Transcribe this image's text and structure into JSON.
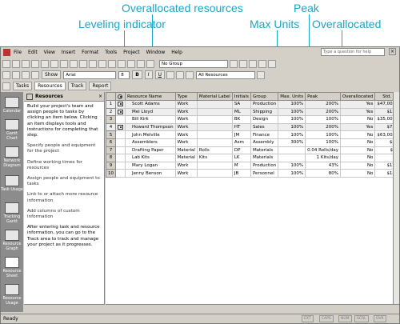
{
  "callouts": {
    "overallocated_resources": "Overallocated resources",
    "leveling_indicator": "Leveling indicator",
    "peak": "Peak",
    "max_units": "Max Units",
    "overallocated": "Overallocated"
  },
  "menu": [
    "File",
    "Edit",
    "View",
    "Insert",
    "Format",
    "Tools",
    "Project",
    "Window",
    "Help"
  ],
  "help_placeholder": "Type a question for help",
  "toolbar": {
    "group_value": "No Group",
    "show_label": "Show",
    "font_value": "Arial",
    "font_size": "8",
    "bold": "B",
    "italic": "I",
    "underline": "U",
    "filter_value": "All Resources"
  },
  "guide_toolbar": [
    "Tasks",
    "Resources",
    "Track",
    "Report"
  ],
  "viewbar": [
    "Calendar",
    "Gantt Chart",
    "Network Diagram",
    "Task Usage",
    "Tracking Gantt",
    "Resource Graph",
    "Resource Sheet",
    "Resource Usage"
  ],
  "guide": {
    "title": "Resources",
    "intro": "Build your project's team and assign people to tasks by clicking an item below. Clicking an item displays tools and instructions for completing that step.",
    "links": [
      "Specify people and equipment for the project",
      "Define working times for resources",
      "Assign people and equipment to tasks",
      "Link to or attach more resource information",
      "Add columns of custom information"
    ],
    "footer": "After entering task and resource information, you can go to the Track area to track and manage your project as it progresses."
  },
  "table": {
    "columns": [
      "",
      "Resource Name",
      "Type",
      "Material Label",
      "Initials",
      "Group",
      "Max. Units",
      "Peak",
      "Overallocated",
      "Std. Rate",
      "O"
    ],
    "rows": [
      {
        "n": "1",
        "ind": true,
        "name": "Scott Adams",
        "type": "Work",
        "label": "",
        "init": "SA",
        "group": "Production",
        "max": "100%",
        "peak": "200%",
        "over": "Yes",
        "rate": "$47,000.00/yr"
      },
      {
        "n": "2",
        "ind": true,
        "name": "Mel Lloyd",
        "type": "Work",
        "label": "",
        "init": "ML",
        "group": "Shipping",
        "max": "100%",
        "peak": "200%",
        "over": "Yes",
        "rate": "$15.00/hr"
      },
      {
        "n": "3",
        "ind": false,
        "name": "Bill Kirk",
        "type": "Work",
        "label": "",
        "init": "BK",
        "group": "Design",
        "max": "100%",
        "peak": "100%",
        "over": "No",
        "rate": "$35,000.00/yr"
      },
      {
        "n": "4",
        "ind": true,
        "name": "Howard Thompson",
        "type": "Work",
        "label": "",
        "init": "HT",
        "group": "Sales",
        "max": "100%",
        "peak": "200%",
        "over": "Yes",
        "rate": "$73.50/hr"
      },
      {
        "n": "5",
        "ind": false,
        "name": "John Melville",
        "type": "Work",
        "label": "",
        "init": "JM",
        "group": "Finance",
        "max": "100%",
        "peak": "100%",
        "over": "No",
        "rate": "$63,000.00/yr"
      },
      {
        "n": "6",
        "ind": false,
        "name": "Assemblers",
        "type": "Work",
        "label": "",
        "init": "Asm",
        "group": "Assembly",
        "max": "300%",
        "peak": "100%",
        "over": "No",
        "rate": "$8.50/hr"
      },
      {
        "n": "7",
        "ind": false,
        "name": "Drafting Paper",
        "type": "Material",
        "label": "Rolls",
        "init": "DP",
        "group": "Materials",
        "max": "",
        "peak": "0.04 Rolls/day",
        "over": "No",
        "rate": "$100.00"
      },
      {
        "n": "8",
        "ind": false,
        "name": "Lab Kits",
        "type": "Material",
        "label": "Kits",
        "init": "LK",
        "group": "Materials",
        "max": "",
        "peak": "1 Kits/day",
        "over": "No",
        "rate": "$10.00"
      },
      {
        "n": "9",
        "ind": false,
        "name": "Mary Logan",
        "type": "Work",
        "label": "",
        "init": "M",
        "group": "Production",
        "max": "100%",
        "peak": "43%",
        "over": "No",
        "rate": "$12.00/hr"
      },
      {
        "n": "10",
        "ind": false,
        "name": "Jenny Benson",
        "type": "Work",
        "label": "",
        "init": "JB",
        "group": "Personnel",
        "max": "100%",
        "peak": "80%",
        "over": "No",
        "rate": "$18.00/hr"
      }
    ]
  },
  "status": {
    "text": "Ready",
    "indicators": [
      "EXT",
      "CAPS",
      "NUM",
      "SCRL",
      "OVR"
    ]
  }
}
